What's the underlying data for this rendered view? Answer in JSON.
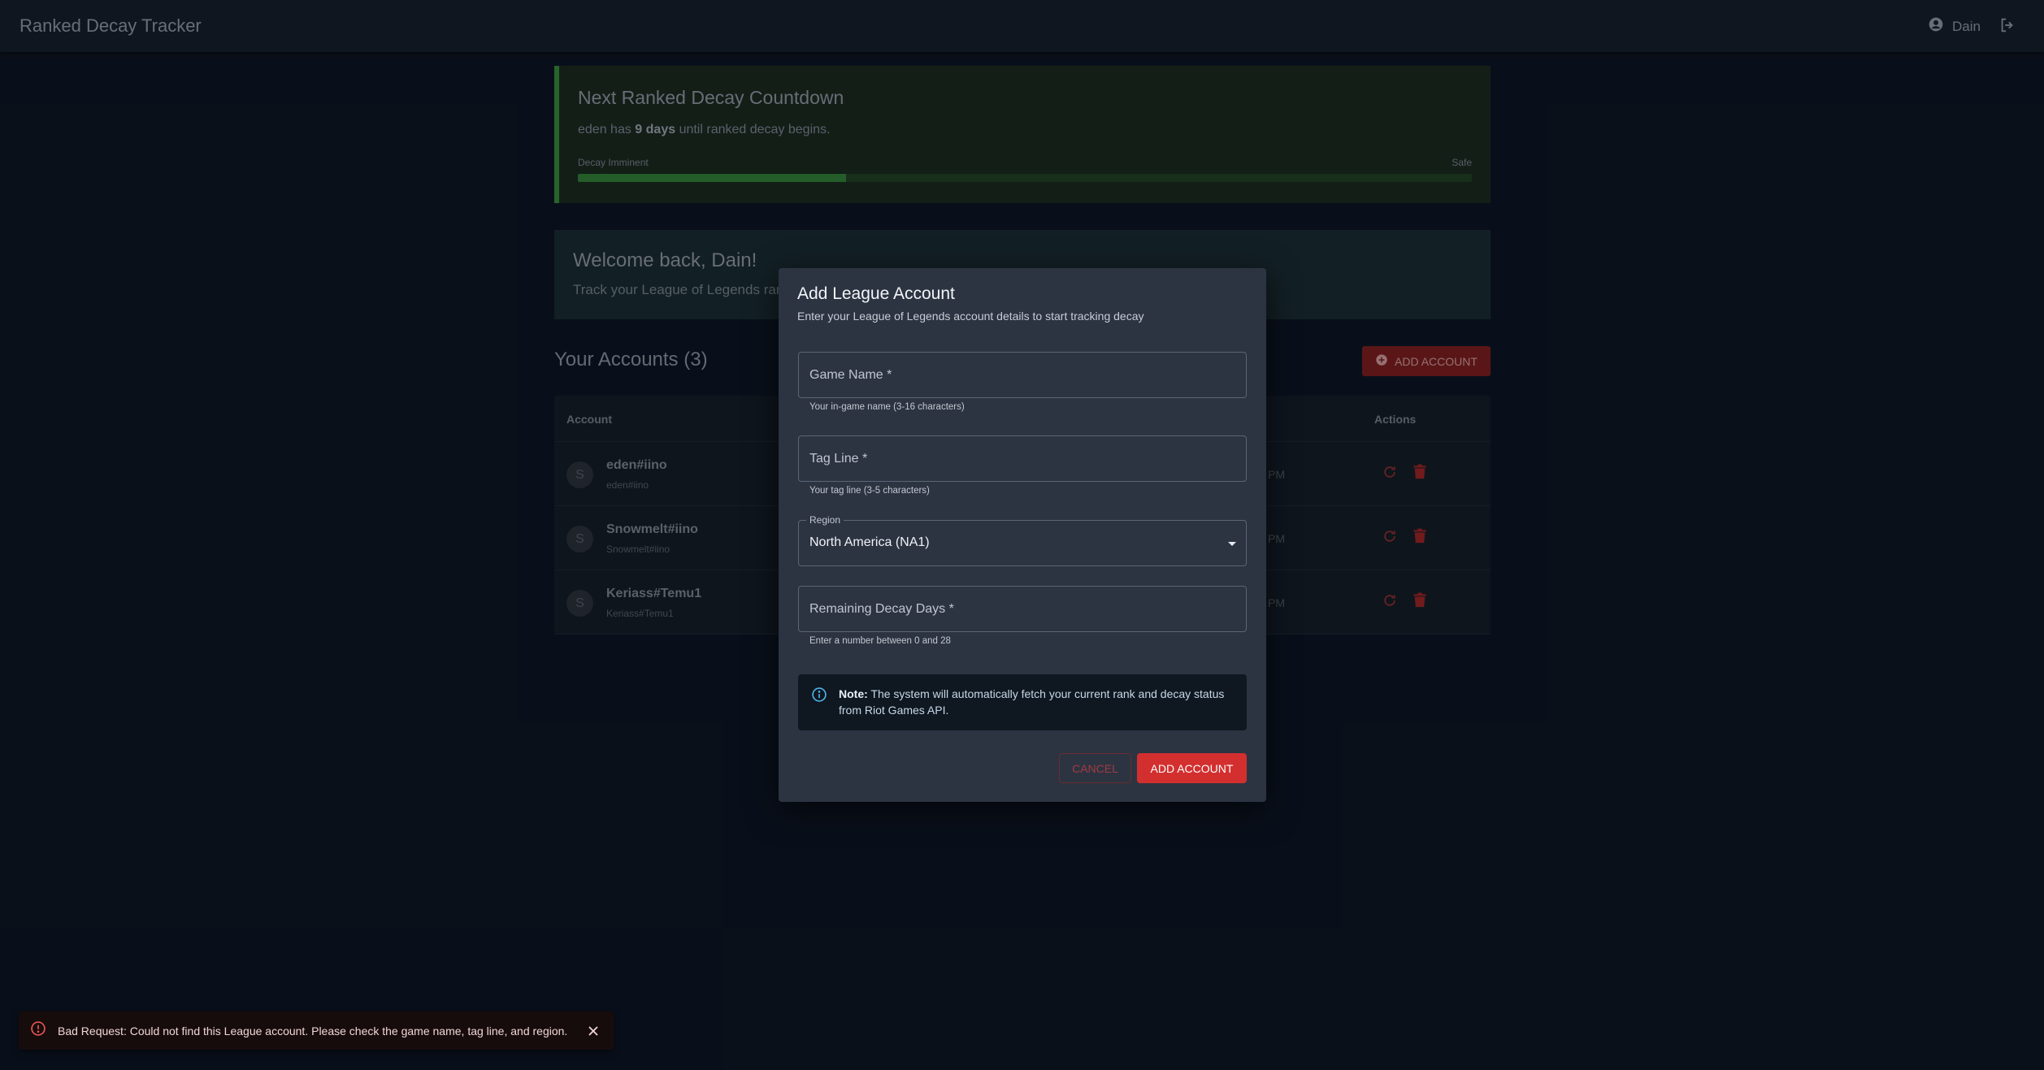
{
  "app": {
    "title": "Ranked Decay Tracker",
    "username": "Dain"
  },
  "countdown": {
    "title": "Next Ranked Decay Countdown",
    "account": "eden",
    "text_mid": "has",
    "days": "9 days",
    "text_end": "until ranked decay begins.",
    "label_left": "Decay Imminent",
    "label_right": "Safe",
    "progress_fraction": 0.3,
    "color": "#2c7233"
  },
  "welcome": {
    "title": "Welcome back, Dain!",
    "subtitle": "Track your League of Legends rank"
  },
  "accounts": {
    "heading": "Your Accounts (3)",
    "add_label": "ADD ACCOUNT",
    "columns": {
      "account": "Account",
      "actions": "Actions"
    },
    "rows": [
      {
        "avatar": "S",
        "name": "eden#iino",
        "sub": "eden#iino",
        "time_fragment": "PM"
      },
      {
        "avatar": "S",
        "name": "Snowmelt#iino",
        "sub": "Snowmelt#iino",
        "time_fragment": "PM"
      },
      {
        "avatar": "S",
        "name": "Keriass#Temu1",
        "sub": "Keriass#Temu1",
        "time_fragment": "PM"
      }
    ]
  },
  "modal": {
    "title": "Add League Account",
    "subtitle": "Enter your League of Legends account details to start tracking decay",
    "game_name": {
      "placeholder": "Game Name *",
      "value": "",
      "helper": "Your in-game name (3-16 characters)"
    },
    "tag_line": {
      "placeholder": "Tag Line *",
      "value": "",
      "helper": "Your tag line (3-5 characters)"
    },
    "region": {
      "label": "Region",
      "value": "North America (NA1)"
    },
    "decay_days": {
      "placeholder": "Remaining Decay Days *",
      "value": "",
      "helper": "Enter a number between 0 and 28"
    },
    "note": {
      "bold": "Note:",
      "text": "The system will automatically fetch your current rank and decay status from Riot Games API."
    },
    "cancel_label": "CANCEL",
    "submit_label": "ADD ACCOUNT",
    "accent": "#d32f2f"
  },
  "snackbar": {
    "message": "Bad Request: Could not find this League account. Please check the game name, tag line, and region."
  },
  "icons": {
    "user": "account-circle-icon",
    "logout": "logout-icon",
    "add": "add-circle-icon",
    "refresh": "refresh-icon",
    "delete": "delete-icon",
    "info": "info-icon",
    "error": "error-icon",
    "close": "close-icon"
  }
}
